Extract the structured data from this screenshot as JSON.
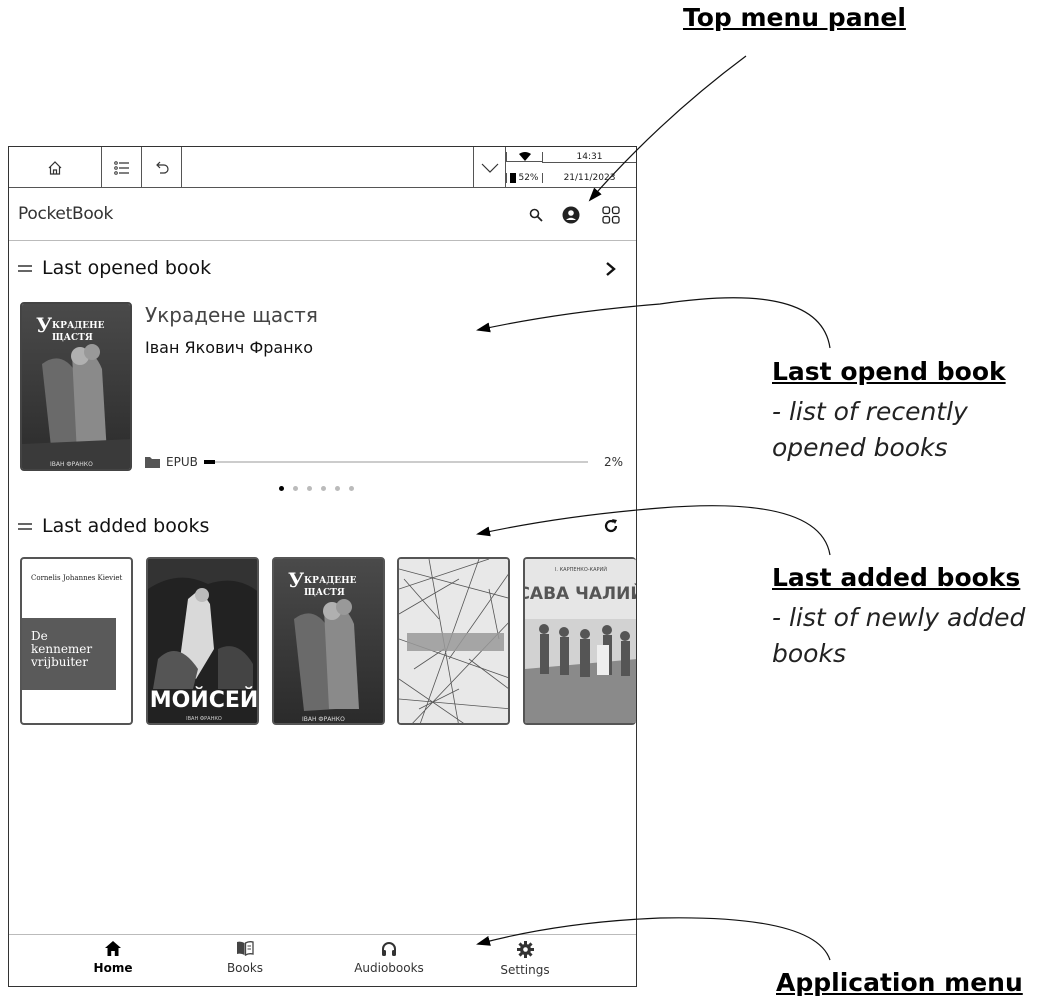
{
  "annotations": {
    "top_menu": {
      "title": "Top menu panel"
    },
    "last_opened": {
      "title": "Last opend book",
      "desc": "- list of recently opened books"
    },
    "last_added": {
      "title": "Last added books",
      "desc": "- list of newly added books"
    },
    "app_menu": {
      "title": "Application menu"
    }
  },
  "statusbar": {
    "battery": "52%",
    "time": "14:31",
    "date": "21/11/2023",
    "icons": [
      "home-icon",
      "toc-icon",
      "back-icon",
      "chevron-down-icon",
      "wifi-icon",
      "battery-icon"
    ]
  },
  "appbar": {
    "brand": "PocketBook",
    "icons": [
      "search-icon",
      "account-icon",
      "grid-view-icon"
    ]
  },
  "last_opened": {
    "title": "Last opened book",
    "book": {
      "title": "Украдене щастя",
      "author": "Іван Якович Франко",
      "format": "EPUB",
      "progress": 0.02,
      "progress_label": "2%"
    },
    "carousel": {
      "pages": 6,
      "active": 0
    }
  },
  "last_added": {
    "title": "Last added books",
    "covers": {
      "kieviet_author": "Cornelis Johannes Kieviet",
      "kieviet_title_l1": "De",
      "kieviet_title_l2": "kennemer",
      "kieviet_title_l3": "vrijbuiter",
      "moisei": "МОЙСЕЙ",
      "ukradene_l1": "КРАДЕНЕ",
      "ukradene_l2": "ЩАСТЯ",
      "ukradene_initial": "У",
      "franko": "ІВАН ФРАНКО",
      "sava_author": "І. КАРПЕНКО-КАРИЙ",
      "sava_title": "САВА ЧАЛИЙ"
    }
  },
  "nav": {
    "items": [
      {
        "label": "Home",
        "icon": "home-icon",
        "active": true
      },
      {
        "label": "Books",
        "icon": "books-icon",
        "active": false
      },
      {
        "label": "Audiobooks",
        "icon": "headphones-icon",
        "active": false
      },
      {
        "label": "Settings",
        "icon": "gear-icon",
        "active": false
      }
    ]
  }
}
